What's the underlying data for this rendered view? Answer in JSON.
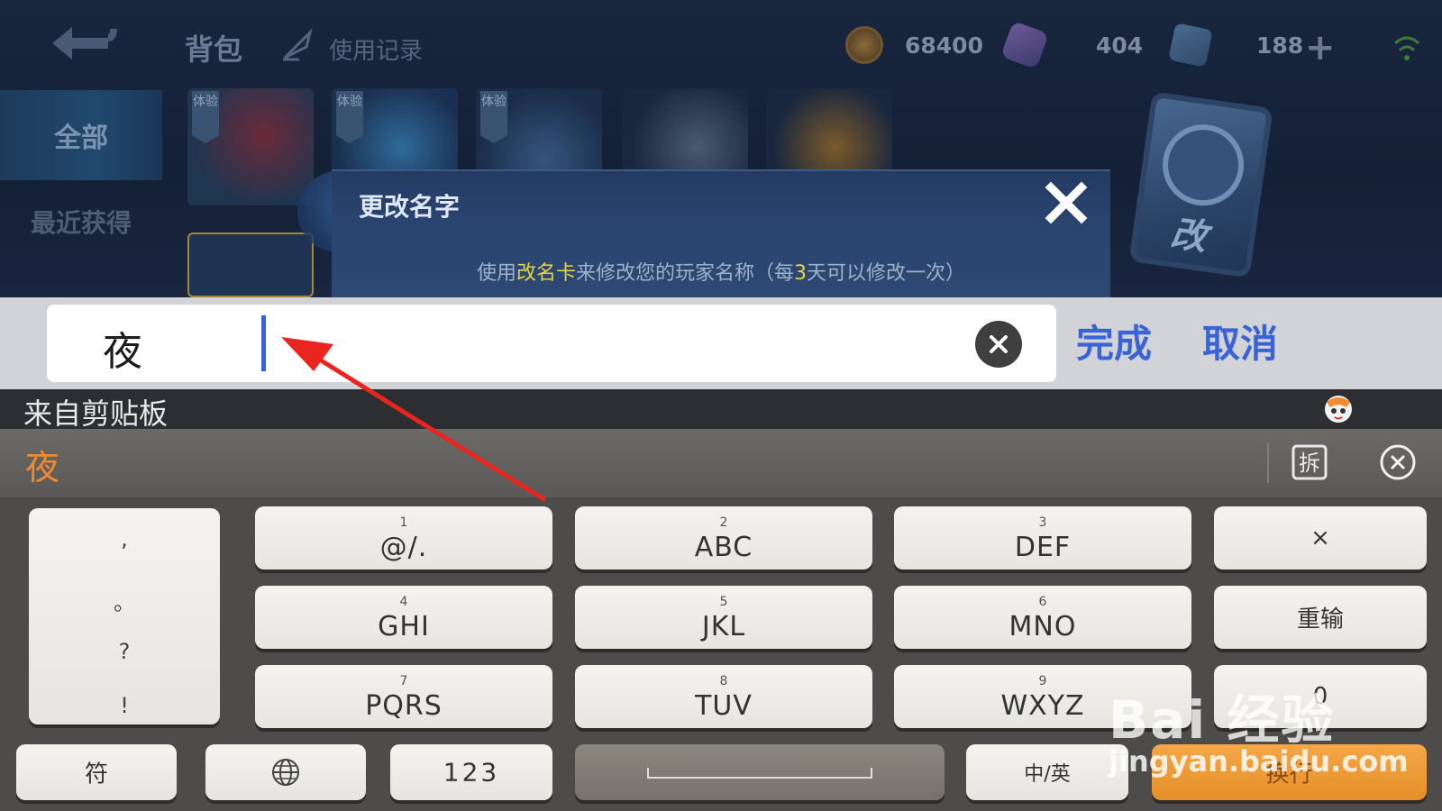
{
  "game": {
    "tab_bag": "背包",
    "tab_history": "使用记录",
    "gold": "68400",
    "diamonds": "404",
    "vouchers": "188",
    "sidebar_all": "全部",
    "sidebar_recent": "最近获得",
    "trial_tag": "体验",
    "card_text": "改"
  },
  "dialog": {
    "title": "更改名字",
    "desc_prefix": "使用",
    "desc_highlight": "改名卡",
    "desc_middle": "来修改您的玩家名称（每",
    "desc_num": "3",
    "desc_suffix": "天可以修改一次）"
  },
  "input": {
    "value": "夜",
    "done_label": "完成",
    "cancel_label": "取消"
  },
  "clipboard": {
    "label": "来自剪贴板"
  },
  "candidates": {
    "first": "夜",
    "split_label": "拆"
  },
  "keyboard": {
    "punct": [
      ",",
      "。",
      "?",
      "!"
    ],
    "keys": [
      {
        "num": "1",
        "letters": "@/."
      },
      {
        "num": "2",
        "letters": "ABC"
      },
      {
        "num": "3",
        "letters": "DEF"
      },
      {
        "num": "4",
        "letters": "GHI"
      },
      {
        "num": "5",
        "letters": "JKL"
      },
      {
        "num": "6",
        "letters": "MNO"
      },
      {
        "num": "7",
        "letters": "PQRS"
      },
      {
        "num": "8",
        "letters": "TUV"
      },
      {
        "num": "9",
        "letters": "WXYZ"
      }
    ],
    "delete_label": "×",
    "reset_label": "重输",
    "zero_label": "0",
    "symbol_label": "符",
    "num_label": "123",
    "lang_label": "中/英",
    "enter_label": "换行"
  },
  "watermark": {
    "logo": "Bai 经验",
    "site": "jingyan.baidu.com"
  },
  "colors": {
    "accent_blue": "#3a64d6",
    "candidate_orange": "#f08a30",
    "highlight_yellow": "#e8d33d",
    "annotation_red": "#e8261f"
  }
}
